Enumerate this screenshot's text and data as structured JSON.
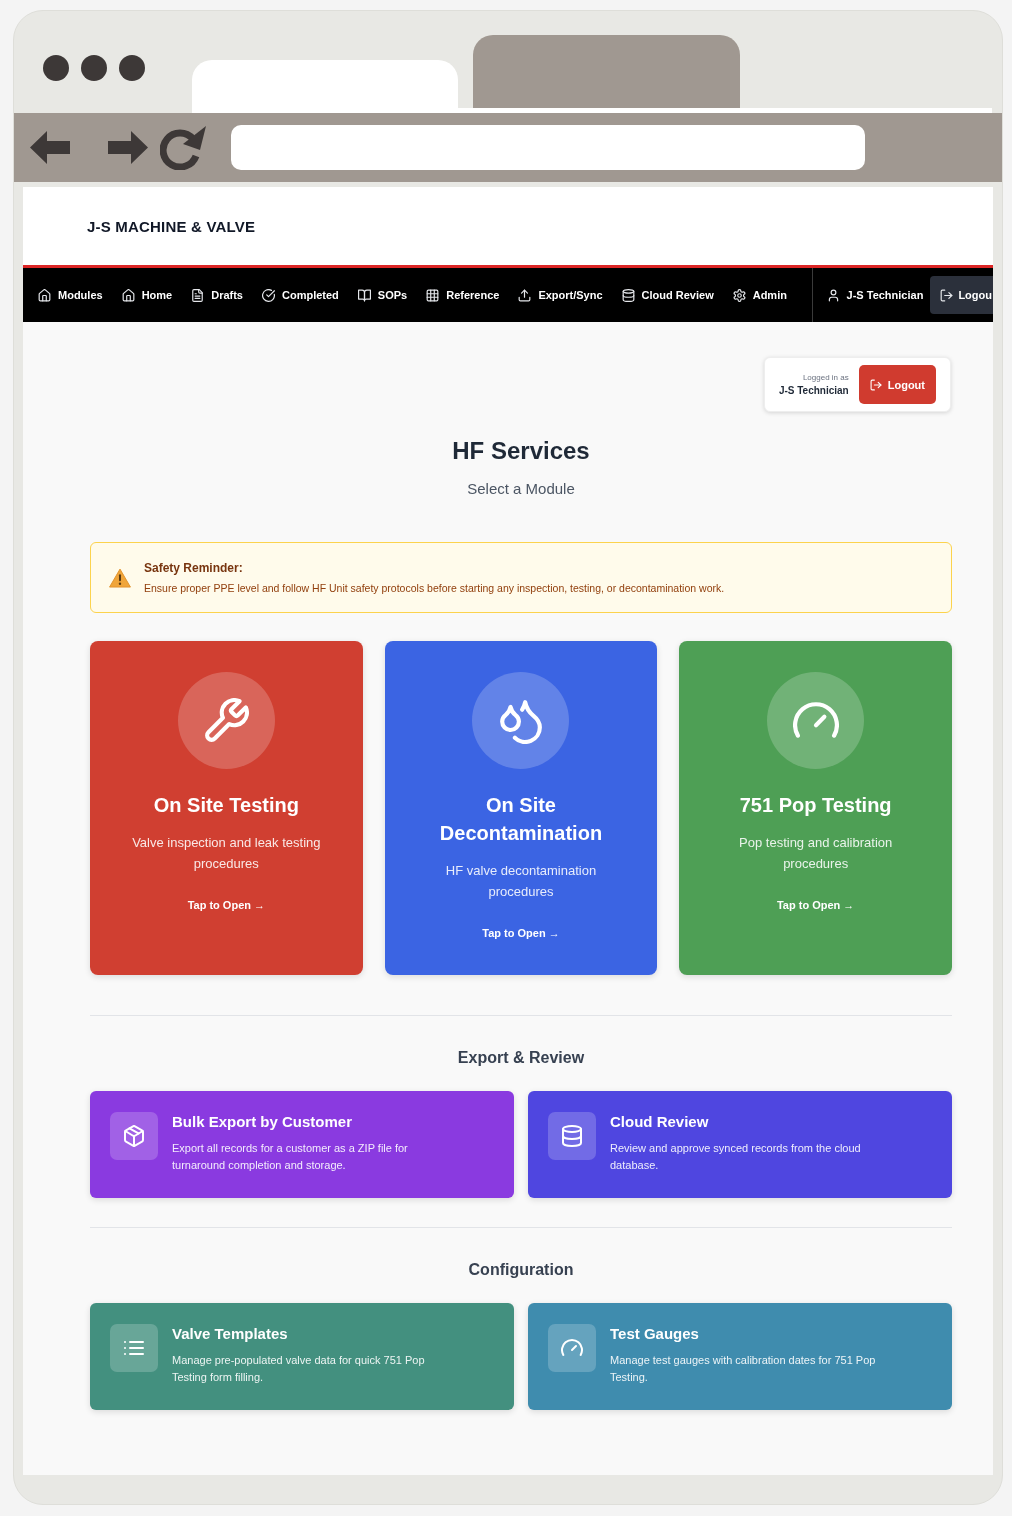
{
  "browser": {
    "tabs": [
      {
        "selected": true
      },
      {
        "selected": false
      }
    ]
  },
  "header": {
    "brand": "J-S MACHINE & VALVE"
  },
  "nav": {
    "items": [
      {
        "label": "Modules"
      },
      {
        "label": "Home"
      },
      {
        "label": "Drafts"
      },
      {
        "label": "Completed"
      },
      {
        "label": "SOPs"
      },
      {
        "label": "Reference"
      },
      {
        "label": "Export/Sync"
      },
      {
        "label": "Cloud Review"
      },
      {
        "label": "Admin"
      }
    ],
    "user": "J-S Technician",
    "logout": "Logou"
  },
  "session": {
    "caption": "Logged in as",
    "user": "J-S Technician",
    "logout": "Logout"
  },
  "heading": {
    "title": "HF Services",
    "subtitle": "Select a Module"
  },
  "safety_notice": {
    "title": "Safety Reminder:",
    "text": "Ensure proper PPE level and follow HF Unit safety protocols before starting any inspection, testing, or decontamination work."
  },
  "modules": [
    {
      "title": "On Site Testing",
      "description": "Valve inspection and leak testing procedures",
      "action": "Tap to Open →",
      "color": "#d03f31"
    },
    {
      "title": "On Site Decontamination",
      "description": "HF valve decontamination procedures",
      "action": "Tap to Open →",
      "color": "#3b64e3"
    },
    {
      "title": "751 Pop Testing",
      "description": "Pop testing and calibration procedures",
      "action": "Tap to Open →",
      "color": "#4e9f55"
    }
  ],
  "sections": [
    {
      "heading": "Export & Review",
      "cards": [
        {
          "title": "Bulk Export by Customer",
          "description": "Export all records for a customer as a ZIP file for turnaround completion and storage.",
          "color": "#8a3ae0"
        },
        {
          "title": "Cloud Review",
          "description": "Review and approve synced records from the cloud database.",
          "color": "#4f46e0"
        }
      ]
    },
    {
      "heading": "Configuration",
      "cards": [
        {
          "title": "Valve Templates",
          "description": "Manage pre-populated valve data for quick 751 Pop Testing form filling.",
          "color": "#43907f"
        },
        {
          "title": "Test Gauges",
          "description": "Manage test gauges with calibration dates for 751 Pop Testing.",
          "color": "#3f8cae"
        }
      ]
    }
  ]
}
